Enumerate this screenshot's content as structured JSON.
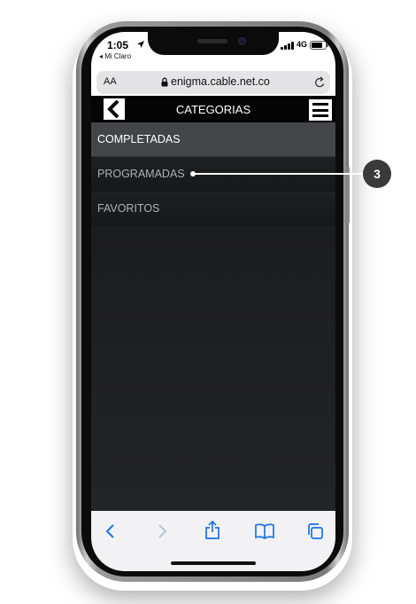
{
  "status_bar": {
    "time": "1:05",
    "carrier": "◂ Mi Claro",
    "network": "4G"
  },
  "browser": {
    "text_size_label": "AA",
    "url": "enigma.cable.net.co"
  },
  "app": {
    "title": "CATEGORIAS",
    "categories": [
      {
        "label": "COMPLETADAS",
        "active": true
      },
      {
        "label": "PROGRAMADAS",
        "active": false
      },
      {
        "label": "FAVORITOS",
        "active": false
      }
    ]
  },
  "toolbar": {
    "icons": [
      "back-icon",
      "forward-icon",
      "share-icon",
      "bookmarks-icon",
      "tabs-icon"
    ]
  },
  "annotation": {
    "number": "3"
  },
  "colors": {
    "active_item_bg": "#444548",
    "list_bg": "#1c1d1f",
    "toolbar_icon": "#1a73e8",
    "badge": "#3a3a3a"
  }
}
